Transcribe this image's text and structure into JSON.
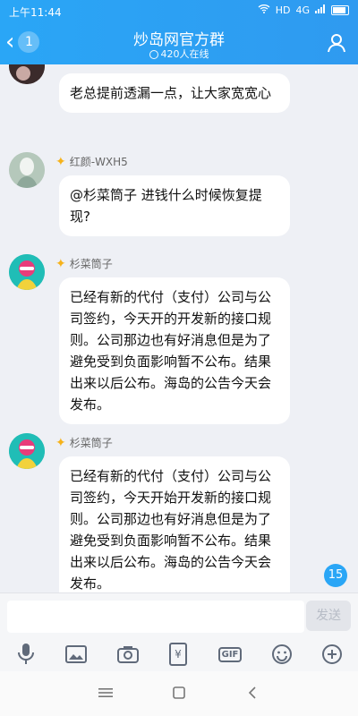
{
  "status": {
    "time": "上午11:44",
    "network": "4G",
    "hd": "HD"
  },
  "header": {
    "back_badge": "1",
    "title": "炒岛网官方群",
    "online": "420人在线"
  },
  "messages": [
    {
      "nickname": "",
      "text": "老总提前透漏一点，让大家宽宽心"
    },
    {
      "nickname": "红颜-WXH5",
      "text": "@杉菜筒子 进钱什么时候恢复提现?"
    },
    {
      "nickname": "杉菜筒子",
      "text": "已经有新的代付（支付）公司与公司签约，今天开的开发新的接口规则。公司那边也有好消息但是为了避免受到负面影响暂不公布。结果出来以后公布。海岛的公告今天会发布。"
    },
    {
      "nickname": "杉菜筒子",
      "text": "已经有新的代付（支付）公司与公司签约，今天开始开发新的接口规则。公司那边也有好消息但是为了避免受到负面影响暂不公布。结果出来以后公布。海岛的公告今天会发布。"
    }
  ],
  "unread_count": "15",
  "composer": {
    "placeholder": "",
    "send_label": "发送"
  },
  "toolbar": {
    "gif_label": "GIF",
    "redpacket_label": "¥"
  },
  "colors": {
    "accent": "#2aa6f6",
    "bubble": "#ffffff",
    "background": "#eef0f5"
  }
}
